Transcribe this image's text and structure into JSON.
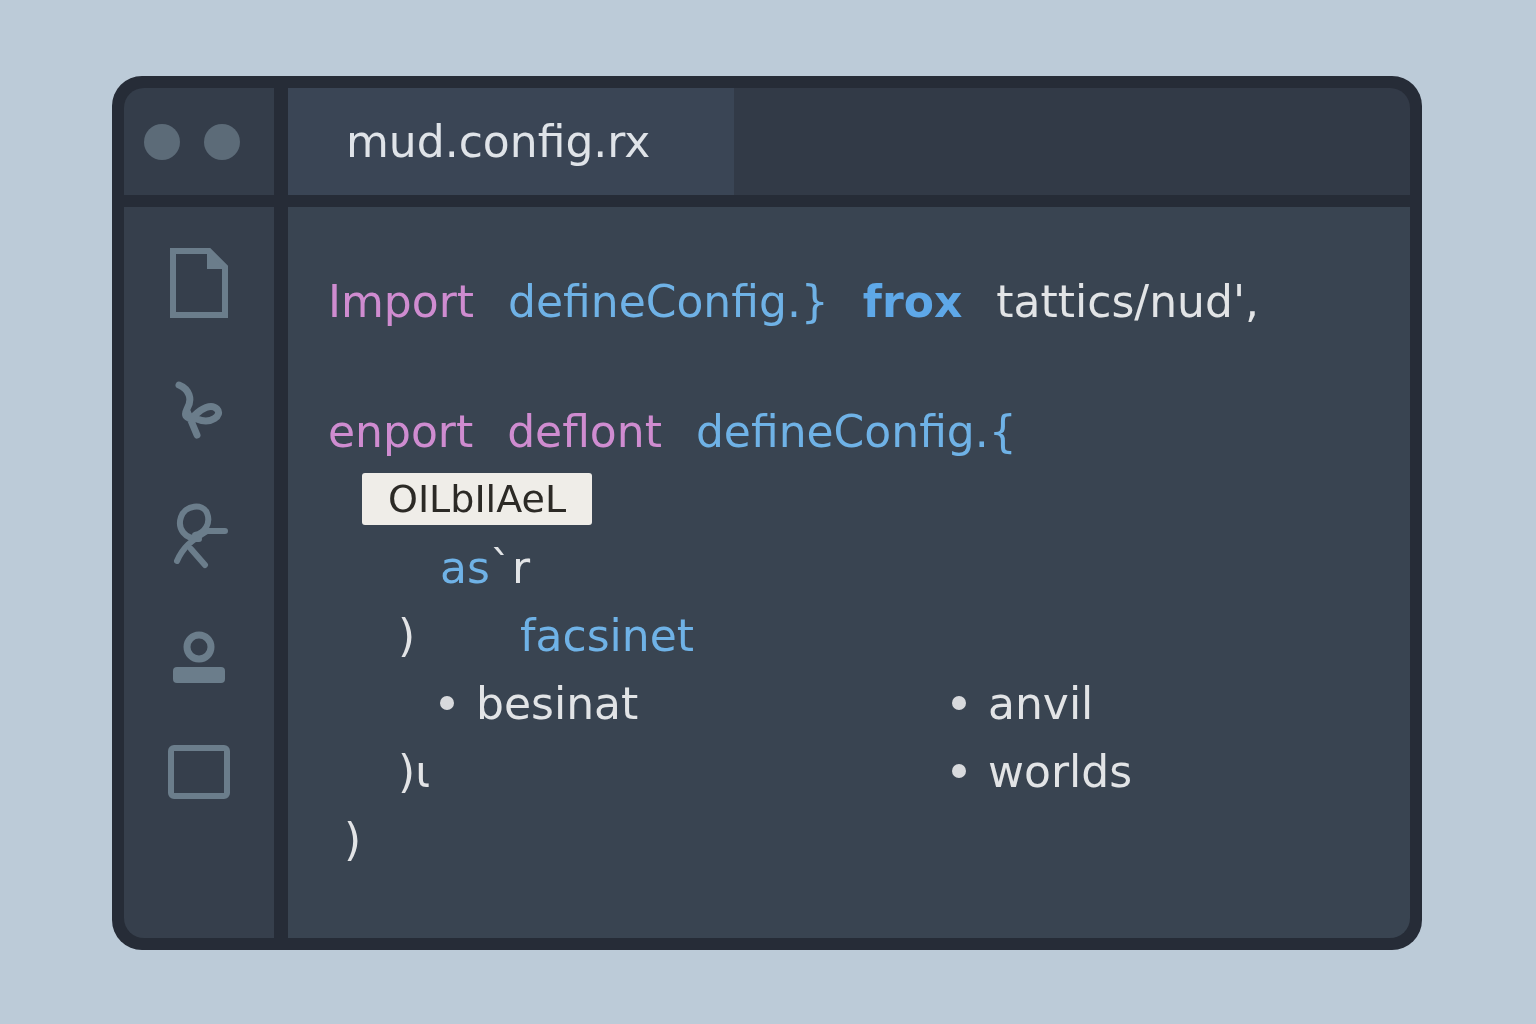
{
  "window": {
    "controls": [
      {
        "kind": "dot"
      },
      {
        "kind": "dot"
      }
    ]
  },
  "sidebar": {
    "icons": [
      {
        "kind": "file"
      },
      {
        "kind": "squiggle"
      },
      {
        "kind": "knot"
      },
      {
        "kind": "person"
      },
      {
        "kind": "square"
      }
    ]
  },
  "tabs": [
    {
      "label": "mud.config.rx",
      "selected": true
    }
  ],
  "code_lines": [
    {
      "kind": "import",
      "tokens": [
        {
          "text": "Import",
          "kind": "keyword"
        },
        {
          "text": "defineConfig.}",
          "kind": "ident"
        },
        {
          "text": "frox",
          "kind": "builtin"
        },
        {
          "text": "tattics/nud',",
          "kind": "plain"
        }
      ]
    },
    {
      "kind": "top",
      "tokens": [
        {
          "text": "enport",
          "kind": "keyword"
        },
        {
          "text": "deflont",
          "kind": "keyword"
        },
        {
          "text": "defineConfig.{",
          "kind": "ident"
        }
      ]
    },
    {
      "kind": "highlight",
      "tokens": [
        {
          "text": "OILbIlAeL",
          "kind": "selection"
        }
      ]
    },
    {
      "kind": "deep",
      "tokens": [
        {
          "text": "as",
          "kind": "ident"
        },
        {
          "text": "`r",
          "kind": "plain"
        }
      ]
    },
    {
      "kind": "nested",
      "tokens": [
        {
          "text": ")",
          "kind": "closer"
        },
        {
          "text": "facsinet",
          "kind": "ident"
        }
      ]
    },
    {
      "kind": "deep",
      "tokens": [
        {
          "text": "besinat",
          "kind": "bullet"
        }
      ],
      "aside": {
        "text": "anvil",
        "kind": "bullet"
      }
    },
    {
      "kind": "nested",
      "tokens": [
        {
          "text": ")ɩ",
          "kind": "closer"
        }
      ],
      "aside": {
        "text": "worlds",
        "kind": "bullet"
      }
    },
    {
      "kind": "end",
      "tokens": [
        {
          "text": ")",
          "kind": "closer"
        }
      ]
    }
  ]
}
